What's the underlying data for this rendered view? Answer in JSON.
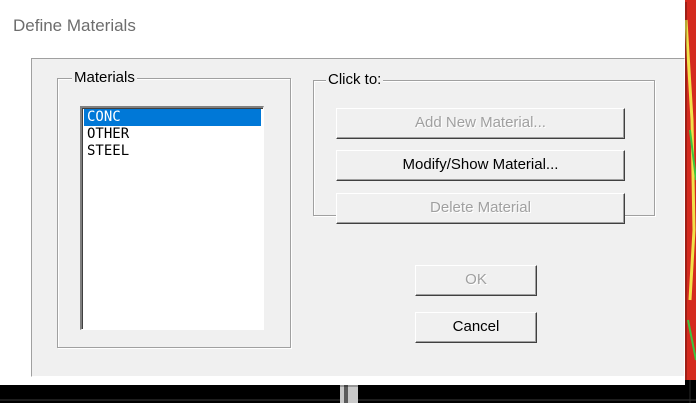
{
  "window": {
    "title": "Define Materials"
  },
  "materials_group": {
    "label": "Materials",
    "items": [
      {
        "label": "CONC",
        "selected": true
      },
      {
        "label": "OTHER",
        "selected": false
      },
      {
        "label": "STEEL",
        "selected": false
      }
    ]
  },
  "actions_group": {
    "label": "Click to:",
    "add_new_material": {
      "label": "Add New Material...",
      "enabled": false
    },
    "modify_show_material": {
      "label": "Modify/Show Material...",
      "enabled": true
    },
    "delete_material": {
      "label": "Delete Material",
      "enabled": false
    }
  },
  "footer": {
    "ok": {
      "label": "OK",
      "enabled": false
    },
    "cancel": {
      "label": "Cancel",
      "enabled": true
    }
  },
  "colors": {
    "selection": "#0078d7",
    "dialog_face": "#f0f0f0",
    "disabled_text": "#a0a0a0"
  }
}
